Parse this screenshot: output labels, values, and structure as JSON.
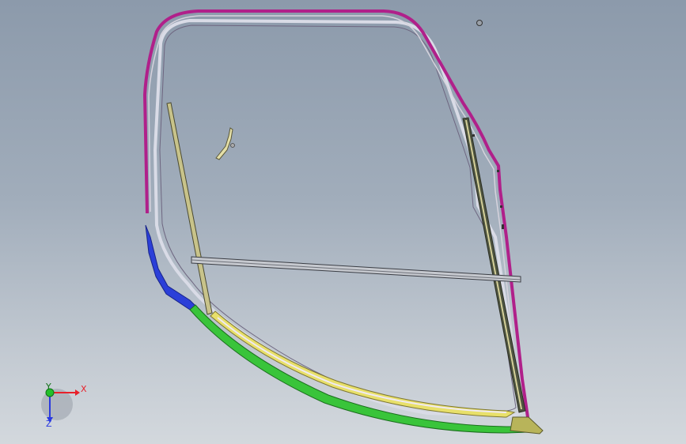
{
  "triad": {
    "x_label": "X",
    "y_label": "Y",
    "z_label": "Z",
    "x_color": "#e8202a",
    "y_color": "#22c02a",
    "z_color": "#2a3ae0"
  },
  "colors": {
    "background_top": "#8c9aab",
    "background_bottom": "#d3d8dd",
    "outer_frame": "#b0208a",
    "bottom_seal": "#39c43a",
    "lower_left_trim": "#2b3fd8",
    "yellow_trim": "#e8e06a",
    "rail": "#c8c38a"
  }
}
